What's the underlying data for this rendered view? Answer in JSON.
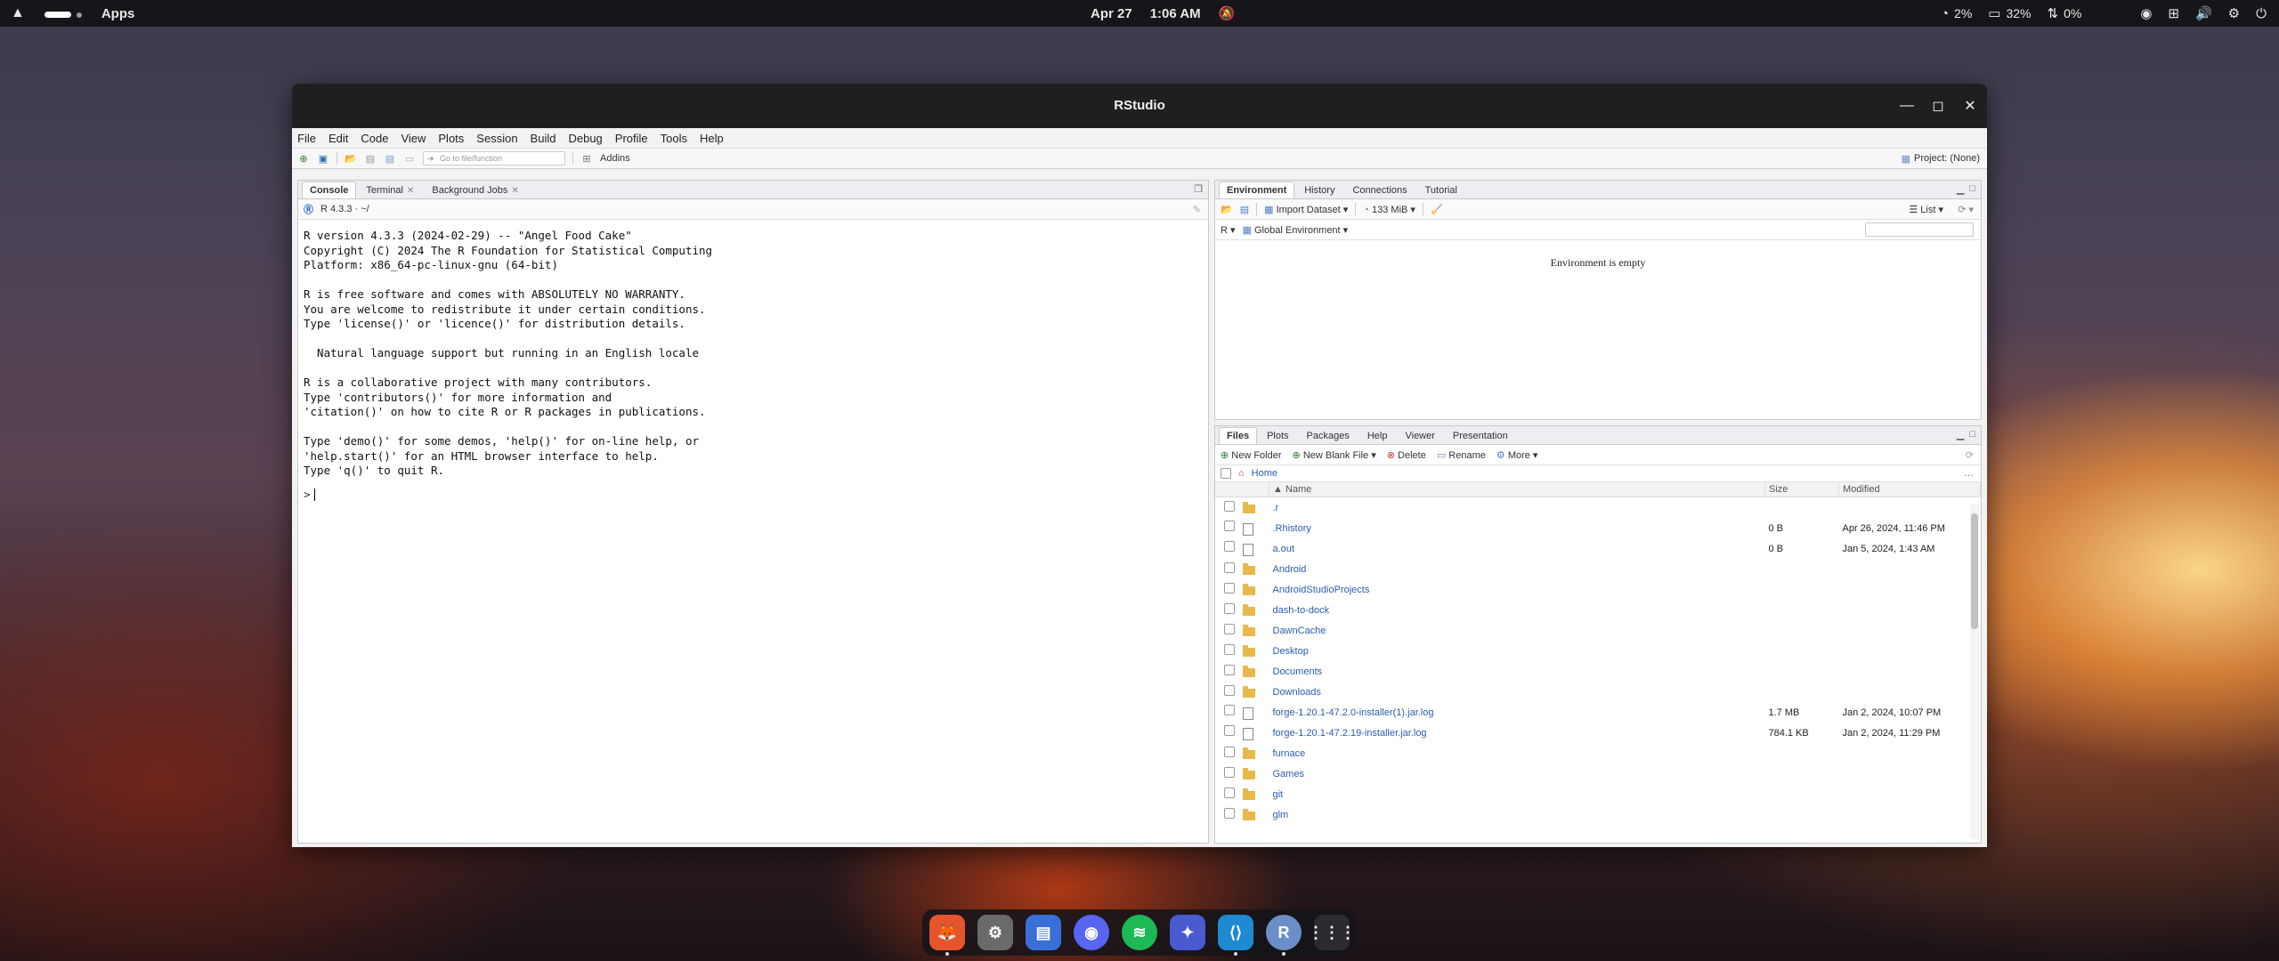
{
  "topbar": {
    "apps_label": "Apps",
    "date": "Apr 27",
    "time": "1:06 AM",
    "cpu": "2%",
    "mem": "32%",
    "net": "0%"
  },
  "window": {
    "title": "RStudio",
    "menu": [
      "File",
      "Edit",
      "Code",
      "View",
      "Plots",
      "Session",
      "Build",
      "Debug",
      "Profile",
      "Tools",
      "Help"
    ],
    "toolbar": {
      "goto_placeholder": "Go to file/function",
      "addins": "Addins",
      "project": "Project: (None)"
    }
  },
  "left_pane": {
    "tabs": [
      {
        "label": "Console",
        "active": true
      },
      {
        "label": "Terminal",
        "closable": true
      },
      {
        "label": "Background Jobs",
        "closable": true
      }
    ],
    "r_version": "R 4.3.3 · ~/",
    "console_lines": [
      "R version 4.3.3 (2024-02-29) -- \"Angel Food Cake\"",
      "Copyright (C) 2024 The R Foundation for Statistical Computing",
      "Platform: x86_64-pc-linux-gnu (64-bit)",
      "",
      "R is free software and comes with ABSOLUTELY NO WARRANTY.",
      "You are welcome to redistribute it under certain conditions.",
      "Type 'license()' or 'licence()' for distribution details.",
      "",
      "  Natural language support but running in an English locale",
      "",
      "R is a collaborative project with many contributors.",
      "Type 'contributors()' for more information and",
      "'citation()' on how to cite R or R packages in publications.",
      "",
      "Type 'demo()' for some demos, 'help()' for on-line help, or",
      "'help.start()' for an HTML browser interface to help.",
      "Type 'q()' to quit R."
    ],
    "prompt": ">"
  },
  "env_pane": {
    "tabs": [
      "Environment",
      "History",
      "Connections",
      "Tutorial"
    ],
    "import_dataset": "Import Dataset",
    "memory": "133 MiB",
    "list_view": "List",
    "lang": "R",
    "scope": "Global Environment",
    "empty_msg": "Environment is empty"
  },
  "files_pane": {
    "tabs": [
      "Files",
      "Plots",
      "Packages",
      "Help",
      "Viewer",
      "Presentation"
    ],
    "actions": {
      "new_folder": "New Folder",
      "new_blank_file": "New Blank File",
      "delete": "Delete",
      "rename": "Rename",
      "more": "More"
    },
    "path": "Home",
    "columns": {
      "name": "Name",
      "size": "Size",
      "modified": "Modified"
    },
    "rows": [
      {
        "name": ".r",
        "type": "folder",
        "size": "",
        "modified": ""
      },
      {
        "name": ".Rhistory",
        "type": "file",
        "size": "0 B",
        "modified": "Apr 26, 2024, 11:46 PM"
      },
      {
        "name": "a.out",
        "type": "file",
        "size": "0 B",
        "modified": "Jan 5, 2024, 1:43 AM"
      },
      {
        "name": "Android",
        "type": "folder",
        "size": "",
        "modified": ""
      },
      {
        "name": "AndroidStudioProjects",
        "type": "folder",
        "size": "",
        "modified": ""
      },
      {
        "name": "dash-to-dock",
        "type": "folder",
        "size": "",
        "modified": ""
      },
      {
        "name": "DawnCache",
        "type": "folder",
        "size": "",
        "modified": ""
      },
      {
        "name": "Desktop",
        "type": "folder",
        "size": "",
        "modified": ""
      },
      {
        "name": "Documents",
        "type": "folder",
        "size": "",
        "modified": ""
      },
      {
        "name": "Downloads",
        "type": "folder",
        "size": "",
        "modified": ""
      },
      {
        "name": "forge-1.20.1-47.2.0-installer(1).jar.log",
        "type": "file",
        "size": "1.7 MB",
        "modified": "Jan 2, 2024, 10:07 PM"
      },
      {
        "name": "forge-1.20.1-47.2.19-installer.jar.log",
        "type": "file",
        "size": "784.1 KB",
        "modified": "Jan 2, 2024, 11:29 PM"
      },
      {
        "name": "furnace",
        "type": "folder",
        "size": "",
        "modified": ""
      },
      {
        "name": "Games",
        "type": "folder",
        "size": "",
        "modified": ""
      },
      {
        "name": "git",
        "type": "folder",
        "size": "",
        "modified": ""
      },
      {
        "name": "glm",
        "type": "folder",
        "size": "",
        "modified": ""
      }
    ]
  },
  "dock": [
    {
      "name": "firefox-icon",
      "color": "#e5542b"
    },
    {
      "name": "settings-icon",
      "color": "#6a6a6a"
    },
    {
      "name": "files-icon",
      "color": "#3a6fd8"
    },
    {
      "name": "discord-icon",
      "color": "#5865f2"
    },
    {
      "name": "spotify-icon",
      "color": "#1db954"
    },
    {
      "name": "game-icon",
      "color": "#4a5ad0"
    },
    {
      "name": "vscode-icon",
      "color": "#1f8ad2"
    },
    {
      "name": "rstudio-icon",
      "color": "#6a8fc8"
    },
    {
      "name": "app-grid-icon",
      "color": "#2b2b30"
    }
  ],
  "dock_labels": {
    "rstudio": "R"
  }
}
